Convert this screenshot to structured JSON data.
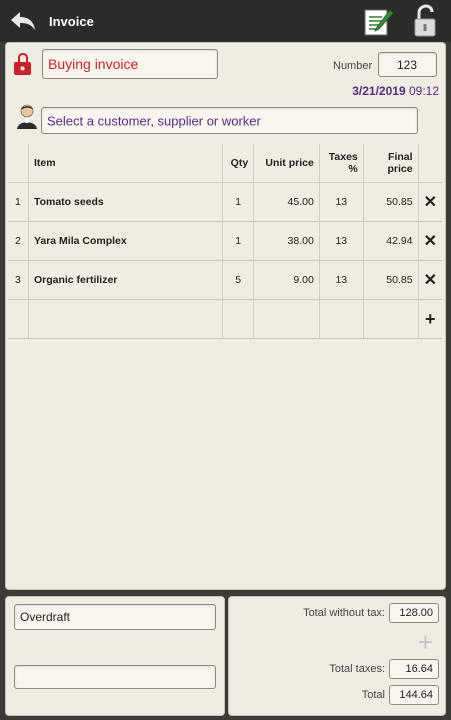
{
  "header": {
    "title": "Invoice",
    "back_icon": "back-arrow-icon",
    "notes_icon": "notepad-icon",
    "lock_icon": "unlocked-padlock-icon"
  },
  "invoice": {
    "type_value": "Buying invoice",
    "number_label": "Number",
    "number_value": "123",
    "date": "3/21/2019",
    "time": "09:12",
    "customer_placeholder": "Select a customer, supplier or worker"
  },
  "table": {
    "headers": {
      "index": "",
      "item": "Item",
      "qty": "Qty",
      "unit_price": "Unit price",
      "taxes": "Taxes %",
      "final_price": "Final price"
    },
    "rows": [
      {
        "index": "1",
        "item": "Tomato seeds",
        "qty": "1",
        "unit_price": "45.00",
        "taxes": "13",
        "final_price": "50.85"
      },
      {
        "index": "2",
        "item": "Yara Mila Complex",
        "qty": "1",
        "unit_price": "38.00",
        "taxes": "13",
        "final_price": "42.94"
      },
      {
        "index": "3",
        "item": "Organic fertilizer",
        "qty": "5",
        "unit_price": "9.00",
        "taxes": "13",
        "final_price": "50.85"
      }
    ]
  },
  "payment": {
    "method": "Overdraft",
    "note": ""
  },
  "totals": {
    "without_tax_label": "Total without tax:",
    "without_tax_value": "128.00",
    "taxes_label": "Total taxes:",
    "taxes_value": "16.64",
    "total_label": "Total",
    "total_value": "144.64"
  },
  "colors": {
    "invoice_type_text": "#d0202a",
    "customer_text": "#5c2a86",
    "date_text": "#5c2a86",
    "delete": "#dd2222",
    "add": "#46a631"
  }
}
